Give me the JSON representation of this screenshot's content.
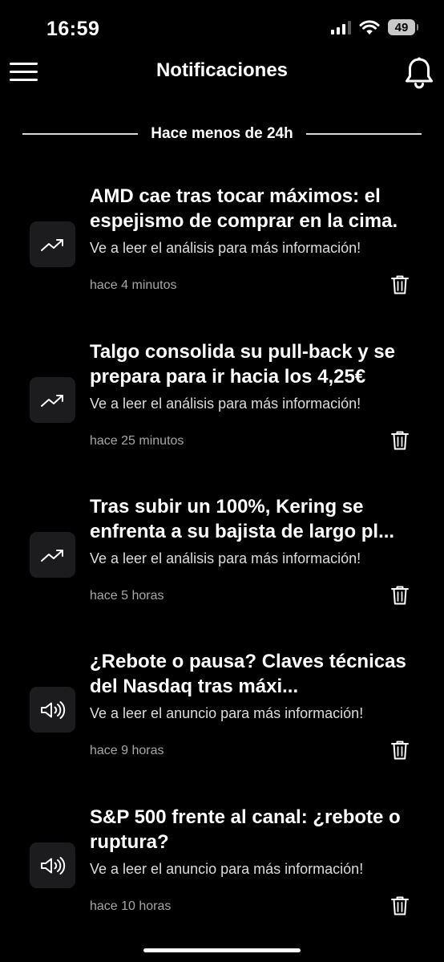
{
  "status_bar": {
    "time": "16:59",
    "battery": "49"
  },
  "header": {
    "title": "Notificaciones"
  },
  "section": {
    "label": "Hace menos de 24h"
  },
  "notifications": [
    {
      "icon": "trending-up-icon",
      "title": "AMD cae tras tocar máximos: el espejismo de comprar en la cima.",
      "body": "Ve a leer el análisis para más información!",
      "time": "hace 4 minutos"
    },
    {
      "icon": "trending-up-icon",
      "title": "Talgo consolida su pull-back y se prepara para ir hacia los 4,25€",
      "body": "Ve a leer el análisis para más información!",
      "time": "hace 25 minutos"
    },
    {
      "icon": "trending-up-icon",
      "title": "Tras subir un 100%, Kering se enfrenta a su bajista de largo pl...",
      "body": "Ve a leer el análisis para más información!",
      "time": "hace 5 horas"
    },
    {
      "icon": "speaker-icon",
      "title": "¿Rebote o pausa? Claves técnicas del Nasdaq tras máxi...",
      "body": "Ve a leer el anuncio para más información!",
      "time": "hace 9 horas"
    },
    {
      "icon": "speaker-icon",
      "title": "S&P 500 frente al canal: ¿rebote o ruptura?",
      "body": "Ve a leer el anuncio para más información!",
      "time": "hace 10 horas"
    }
  ]
}
